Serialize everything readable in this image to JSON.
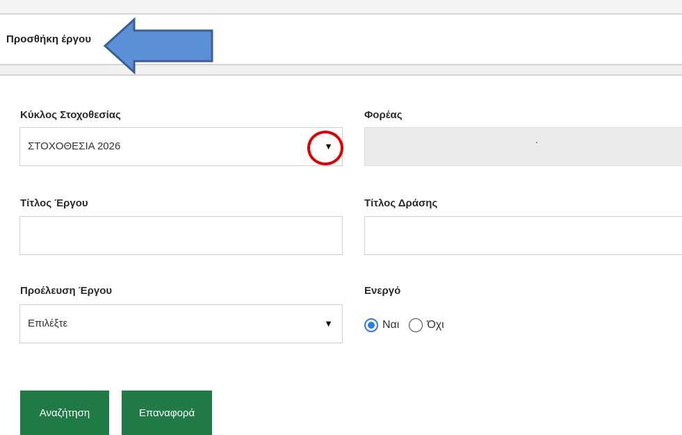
{
  "header": {
    "title": "Προσθήκη έργου"
  },
  "form": {
    "cycle": {
      "label": "Κύκλος Στοχοθεσίας",
      "value": "ΣΤΟΧΟΘΕΣΙΑ 2026",
      "caret": "▼"
    },
    "agency": {
      "label": "Φορέας",
      "value": "."
    },
    "project_title": {
      "label": "Τίτλος Έργου",
      "value": ""
    },
    "action_title": {
      "label": "Τίτλος Δράσης",
      "value": ""
    },
    "origin": {
      "label": "Προέλευση Έργου",
      "value": "Επιλέξτε",
      "caret": "▼"
    },
    "active": {
      "label": "Ενεργό",
      "options": [
        "Ναι",
        "Όχι"
      ],
      "selected": "Ναι"
    }
  },
  "buttons": {
    "search": "Αναζήτηση",
    "reset": "Επαναφορά"
  },
  "colors": {
    "primary_button": "#1f7a45",
    "annotation_arrow": "#5b8fd6",
    "annotation_circle": "#e00000",
    "radio_accent": "#2d7be5"
  }
}
